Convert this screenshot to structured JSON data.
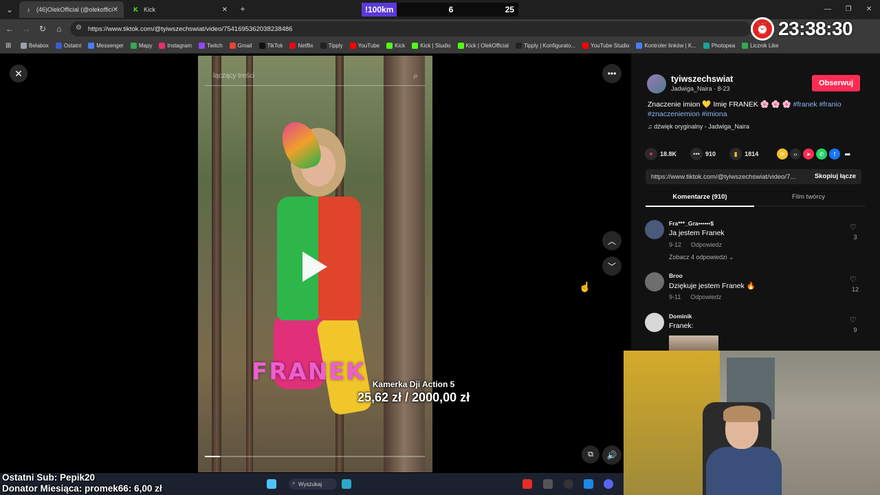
{
  "browser": {
    "tabs": [
      {
        "title": "(46)OlekOfficial (@olekofficial_",
        "favicon": "tiktok-icon",
        "active": true
      },
      {
        "title": "Kick",
        "favicon": "kick-icon",
        "active": false
      }
    ],
    "url": "https://www.tiktok.com/@tyiwszechswiat/video/7541695362038238486",
    "bookmarks": [
      {
        "label": "Belabox",
        "color": "#9aa0a6"
      },
      {
        "label": "Ostatni",
        "color": "#3b5ccf"
      },
      {
        "label": "Messenger",
        "color": "#4a7cff"
      },
      {
        "label": "Mapy",
        "color": "#34a853"
      },
      {
        "label": "Instagram",
        "color": "#e1306c"
      },
      {
        "label": "Twitch",
        "color": "#9146ff"
      },
      {
        "label": "Gmail",
        "color": "#ea4335"
      },
      {
        "label": "TikTok",
        "color": "#111111"
      },
      {
        "label": "Netflix",
        "color": "#e50914"
      },
      {
        "label": "Tipply",
        "color": "#222222"
      },
      {
        "label": "YouTube",
        "color": "#ff0000"
      },
      {
        "label": "Kick",
        "color": "#53fc18"
      },
      {
        "label": "Kick | Studio",
        "color": "#53fc18"
      },
      {
        "label": "Kick | OlekOfficial",
        "color": "#53fc18"
      },
      {
        "label": "Tipply | Konfigurato...",
        "color": "#222222"
      },
      {
        "label": "YouTube Studio",
        "color": "#ff0000"
      },
      {
        "label": "Kontroler linków | K...",
        "color": "#4a7cff"
      },
      {
        "label": "Photopea",
        "color": "#18a497"
      },
      {
        "label": "Licznik Like",
        "color": "#34a853"
      }
    ]
  },
  "clock": {
    "time": "23:38:30"
  },
  "video": {
    "search_placeholder": "łączący treści",
    "overlay_text": "FRANEK",
    "progress_fraction": 0.07
  },
  "post": {
    "username": "tyiwszechswiat",
    "subline": "Jadwiga_Naira · 8-23",
    "follow_label": "Obserwuj",
    "description_plain": "Znaczenie imion 💛 Imię FRANEK 🌸 🌸 🌸 ",
    "hashtags_line1": "#franek #franio",
    "hashtags_line2": "#znaczeniemion #imiona",
    "sound": "dźwięk oryginalny - Jadwiga_Naira",
    "likes": "18.8K",
    "comments_count": "910",
    "saves": "1814",
    "link": "https://www.tiktok.com/@tyiwszechswiat/video/7...",
    "copy_label": "Skopiuj łącze",
    "tab_comments": "Komentarze (910)",
    "tab_creator": "Film twórcy"
  },
  "comments": [
    {
      "name": "Fra***_Gra••••••$",
      "text": "Ja jestem Franek",
      "date": "9-12",
      "reply": "Odpowiedz",
      "likes": "3",
      "more": "Zobacz 4 odpowiedzi ⌄",
      "avatar_color": "#4a5a7a"
    },
    {
      "name": "Broo",
      "text": "Dziękuje jestem Franek 🔥",
      "date": "9-11",
      "reply": "Odpowiedz",
      "likes": "12",
      "avatar_color": "#6e6e6e"
    },
    {
      "name": "Dominik",
      "text": "Franek:",
      "likes": "9",
      "avatar_color": "#d8d8d8"
    }
  ],
  "donation": {
    "title": "Kamerka Dji Action 5",
    "amount": "25,62 zł / 2000,00 zł"
  },
  "taskbar": {
    "search_label": "Wyszukaj",
    "stat_left": "!100km",
    "stat_mid": "6",
    "stat_right": "25"
  },
  "stream_info": {
    "last_sub": "Ostatni Sub: Pepik20",
    "donor": "Donator Miesiąca: promek66: 6,00 zł"
  }
}
